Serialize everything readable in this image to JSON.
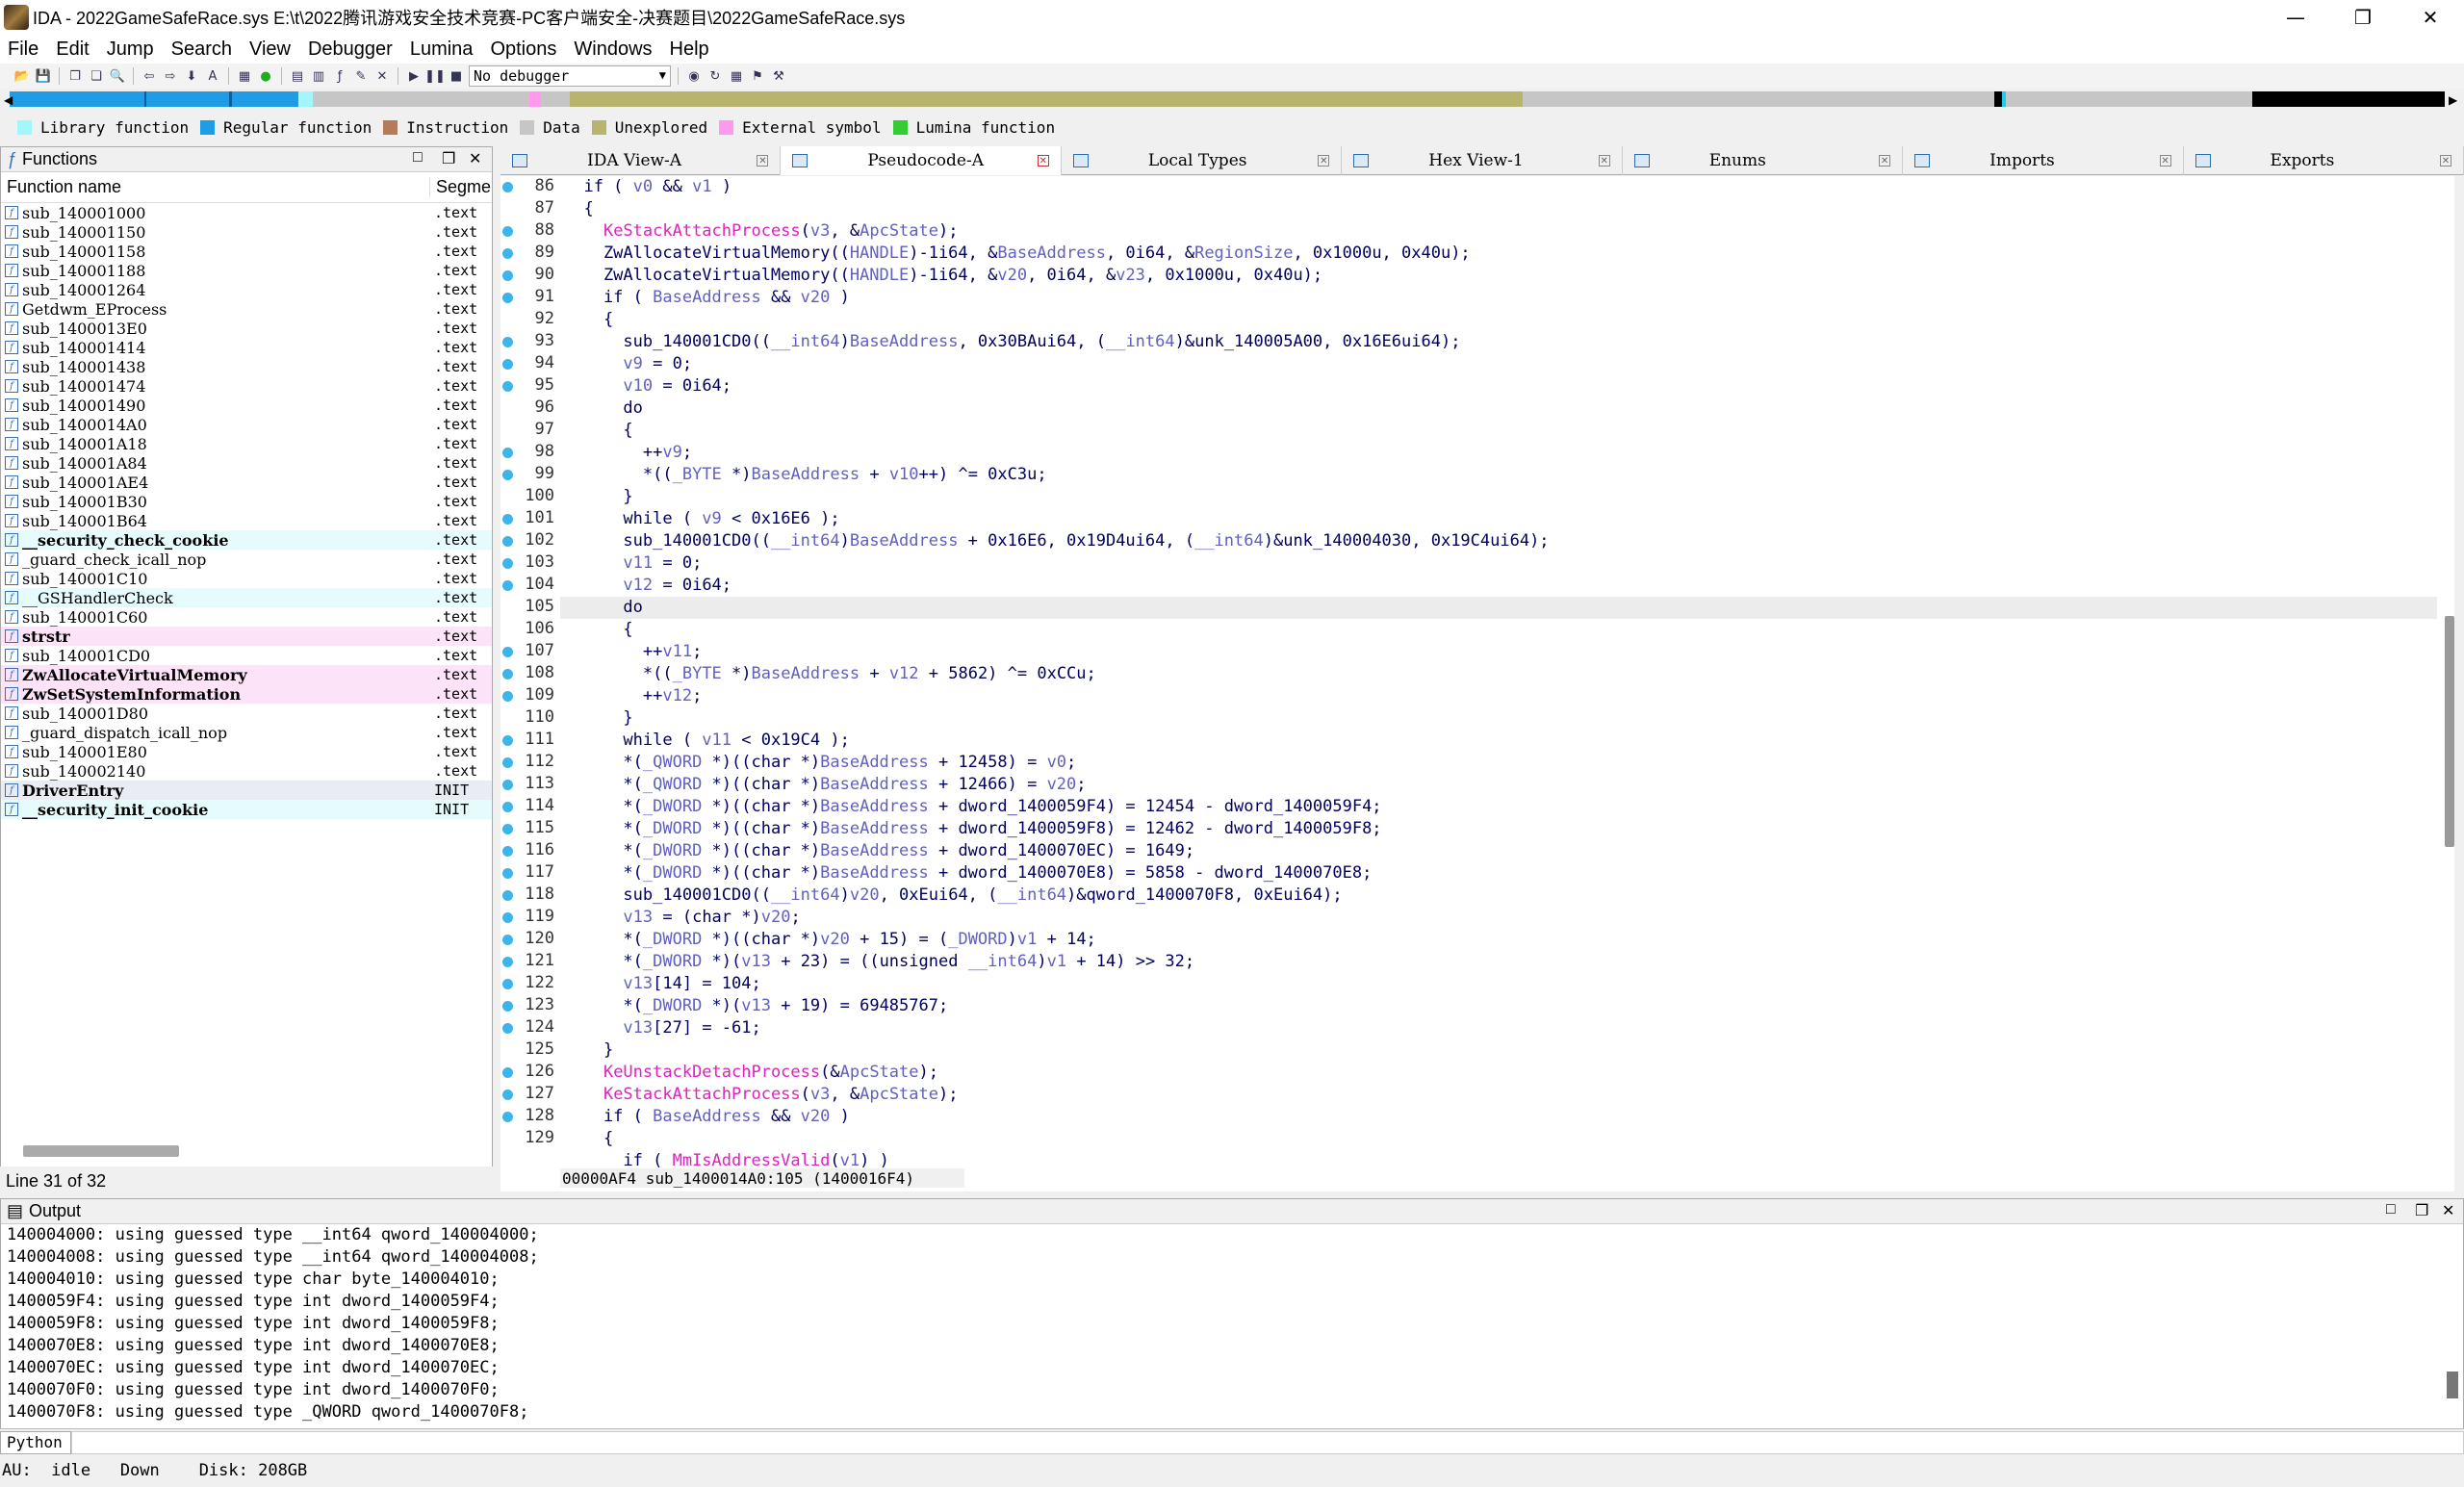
{
  "window": {
    "title": "IDA - 2022GameSafeRace.sys E:\\t\\2022腾讯游戏安全技术竞赛-PC客户端安全-决赛题目\\2022GameSafeRace.sys"
  },
  "menu": [
    "File",
    "Edit",
    "Jump",
    "Search",
    "View",
    "Debugger",
    "Lumina",
    "Options",
    "Windows",
    "Help"
  ],
  "toolbar": {
    "debugger": "No debugger"
  },
  "legend": [
    {
      "label": "Library function",
      "color": "#a3f6fb"
    },
    {
      "label": "Regular function",
      "color": "#1e9ce6"
    },
    {
      "label": "Instruction",
      "color": "#b47a5a"
    },
    {
      "label": "Data",
      "color": "#c6c6c6"
    },
    {
      "label": "Unexplored",
      "color": "#b8b46e"
    },
    {
      "label": "External symbol",
      "color": "#ff99ee"
    },
    {
      "label": "Lumina function",
      "color": "#33cc33"
    }
  ],
  "functions_panel": {
    "title": "Functions",
    "col_name": "Function name",
    "col_seg": "Segme",
    "rows": [
      {
        "name": "sub_140001000",
        "seg": ".text",
        "kind": ""
      },
      {
        "name": "sub_140001150",
        "seg": ".text",
        "kind": ""
      },
      {
        "name": "sub_140001158",
        "seg": ".text",
        "kind": ""
      },
      {
        "name": "sub_140001188",
        "seg": ".text",
        "kind": ""
      },
      {
        "name": "sub_140001264",
        "seg": ".text",
        "kind": ""
      },
      {
        "name": "Getdwm_EProcess",
        "seg": ".text",
        "kind": ""
      },
      {
        "name": "sub_1400013E0",
        "seg": ".text",
        "kind": ""
      },
      {
        "name": "sub_140001414",
        "seg": ".text",
        "kind": ""
      },
      {
        "name": "sub_140001438",
        "seg": ".text",
        "kind": ""
      },
      {
        "name": "sub_140001474",
        "seg": ".text",
        "kind": ""
      },
      {
        "name": "sub_140001490",
        "seg": ".text",
        "kind": ""
      },
      {
        "name": "sub_1400014A0",
        "seg": ".text",
        "kind": ""
      },
      {
        "name": "sub_140001A18",
        "seg": ".text",
        "kind": ""
      },
      {
        "name": "sub_140001A84",
        "seg": ".text",
        "kind": ""
      },
      {
        "name": "sub_140001AE4",
        "seg": ".text",
        "kind": ""
      },
      {
        "name": "sub_140001B30",
        "seg": ".text",
        "kind": ""
      },
      {
        "name": "sub_140001B64",
        "seg": ".text",
        "kind": ""
      },
      {
        "name": "__security_check_cookie",
        "seg": ".text",
        "kind": "lib bold"
      },
      {
        "name": "_guard_check_icall_nop",
        "seg": ".text",
        "kind": ""
      },
      {
        "name": "sub_140001C10",
        "seg": ".text",
        "kind": ""
      },
      {
        "name": "__GSHandlerCheck",
        "seg": ".text",
        "kind": "lib"
      },
      {
        "name": "sub_140001C60",
        "seg": ".text",
        "kind": ""
      },
      {
        "name": "strstr",
        "seg": ".text",
        "kind": "ext bold"
      },
      {
        "name": "sub_140001CD0",
        "seg": ".text",
        "kind": ""
      },
      {
        "name": "ZwAllocateVirtualMemory",
        "seg": ".text",
        "kind": "ext bold"
      },
      {
        "name": "ZwSetSystemInformation",
        "seg": ".text",
        "kind": "ext bold"
      },
      {
        "name": "sub_140001D80",
        "seg": ".text",
        "kind": ""
      },
      {
        "name": "_guard_dispatch_icall_nop",
        "seg": ".text",
        "kind": ""
      },
      {
        "name": "sub_140001E80",
        "seg": ".text",
        "kind": ""
      },
      {
        "name": "sub_140002140",
        "seg": ".text",
        "kind": ""
      },
      {
        "name": "DriverEntry",
        "seg": "INIT",
        "kind": "sel bold"
      },
      {
        "name": "__security_init_cookie",
        "seg": "INIT",
        "kind": "lib bold"
      }
    ],
    "line_info": "Line 31 of 32"
  },
  "tabs": [
    {
      "label": "IDA View-A",
      "active": false
    },
    {
      "label": "Pseudocode-A",
      "active": true
    },
    {
      "label": "Local Types",
      "active": false
    },
    {
      "label": "Hex View-1",
      "active": false
    },
    {
      "label": "Enums",
      "active": false
    },
    {
      "label": "Imports",
      "active": false
    },
    {
      "label": "Exports",
      "active": false
    }
  ],
  "code": {
    "lines": [
      {
        "n": "86",
        "dot": true,
        "t": "  if ( v0 && v1 )"
      },
      {
        "n": "87",
        "dot": false,
        "t": "  {"
      },
      {
        "n": "88",
        "dot": true,
        "t": "    KeStackAttachProcess(v3, &ApcState);"
      },
      {
        "n": "89",
        "dot": true,
        "t": "    ZwAllocateVirtualMemory((HANDLE)-1i64, &BaseAddress, 0i64, &RegionSize, 0x1000u, 0x40u);"
      },
      {
        "n": "90",
        "dot": true,
        "t": "    ZwAllocateVirtualMemory((HANDLE)-1i64, &v20, 0i64, &v23, 0x1000u, 0x40u);"
      },
      {
        "n": "91",
        "dot": true,
        "t": "    if ( BaseAddress && v20 )"
      },
      {
        "n": "92",
        "dot": false,
        "t": "    {"
      },
      {
        "n": "93",
        "dot": true,
        "t": "      sub_140001CD0((__int64)BaseAddress, 0x30BAui64, (__int64)&unk_140005A00, 0x16E6ui64);"
      },
      {
        "n": "94",
        "dot": true,
        "t": "      v9 = 0;"
      },
      {
        "n": "95",
        "dot": true,
        "t": "      v10 = 0i64;"
      },
      {
        "n": "96",
        "dot": false,
        "t": "      do"
      },
      {
        "n": "97",
        "dot": false,
        "t": "      {"
      },
      {
        "n": "98",
        "dot": true,
        "t": "        ++v9;"
      },
      {
        "n": "99",
        "dot": true,
        "t": "        *((_BYTE *)BaseAddress + v10++) ^= 0xC3u;"
      },
      {
        "n": "100",
        "dot": false,
        "t": "      }"
      },
      {
        "n": "101",
        "dot": true,
        "t": "      while ( v9 < 0x16E6 );"
      },
      {
        "n": "102",
        "dot": true,
        "t": "      sub_140001CD0((__int64)BaseAddress + 0x16E6, 0x19D4ui64, (__int64)&unk_140004030, 0x19C4ui64);"
      },
      {
        "n": "103",
        "dot": true,
        "t": "      v11 = 0;"
      },
      {
        "n": "104",
        "dot": true,
        "t": "      v12 = 0i64;"
      },
      {
        "n": "105",
        "dot": false,
        "t": "      do",
        "cur": true
      },
      {
        "n": "106",
        "dot": false,
        "t": "      {"
      },
      {
        "n": "107",
        "dot": true,
        "t": "        ++v11;"
      },
      {
        "n": "108",
        "dot": true,
        "t": "        *((_BYTE *)BaseAddress + v12 + 5862) ^= 0xCCu;"
      },
      {
        "n": "109",
        "dot": true,
        "t": "        ++v12;"
      },
      {
        "n": "110",
        "dot": false,
        "t": "      }"
      },
      {
        "n": "111",
        "dot": true,
        "t": "      while ( v11 < 0x19C4 );"
      },
      {
        "n": "112",
        "dot": true,
        "t": "      *(_QWORD *)((char *)BaseAddress + 12458) = v0;"
      },
      {
        "n": "113",
        "dot": true,
        "t": "      *(_QWORD *)((char *)BaseAddress + 12466) = v20;"
      },
      {
        "n": "114",
        "dot": true,
        "t": "      *(_DWORD *)((char *)BaseAddress + dword_1400059F4) = 12454 - dword_1400059F4;"
      },
      {
        "n": "115",
        "dot": true,
        "t": "      *(_DWORD *)((char *)BaseAddress + dword_1400059F8) = 12462 - dword_1400059F8;"
      },
      {
        "n": "116",
        "dot": true,
        "t": "      *(_DWORD *)((char *)BaseAddress + dword_1400070EC) = 1649;"
      },
      {
        "n": "117",
        "dot": true,
        "t": "      *(_DWORD *)((char *)BaseAddress + dword_1400070E8) = 5858 - dword_1400070E8;"
      },
      {
        "n": "118",
        "dot": true,
        "t": "      sub_140001CD0((__int64)v20, 0xEui64, (__int64)&qword_1400070F8, 0xEui64);"
      },
      {
        "n": "119",
        "dot": true,
        "t": "      v13 = (char *)v20;"
      },
      {
        "n": "120",
        "dot": true,
        "t": "      *(_DWORD *)((char *)v20 + 15) = (_DWORD)v1 + 14;"
      },
      {
        "n": "121",
        "dot": true,
        "t": "      *(_DWORD *)(v13 + 23) = ((unsigned __int64)v1 + 14) >> 32;"
      },
      {
        "n": "122",
        "dot": true,
        "t": "      v13[14] = 104;"
      },
      {
        "n": "123",
        "dot": true,
        "t": "      *(_DWORD *)(v13 + 19) = 69485767;"
      },
      {
        "n": "124",
        "dot": true,
        "t": "      v13[27] = -61;"
      },
      {
        "n": "125",
        "dot": false,
        "t": "    }"
      },
      {
        "n": "126",
        "dot": true,
        "t": "    KeUnstackDetachProcess(&ApcState);"
      },
      {
        "n": "127",
        "dot": true,
        "t": "    KeStackAttachProcess(v3, &ApcState);"
      },
      {
        "n": "128",
        "dot": true,
        "t": "    if ( BaseAddress && v20 )"
      },
      {
        "n": "129",
        "dot": false,
        "t": "    {"
      },
      {
        "n": "",
        "dot": false,
        "t": "      if ( MmIsAddressValid(v1) )"
      }
    ],
    "status": "00000AF4 sub_1400014A0:105 (1400016F4)"
  },
  "output_panel": {
    "title": "Output",
    "lines": [
      "140004000: using guessed type __int64 qword_140004000;",
      "140004008: using guessed type __int64 qword_140004008;",
      "140004010: using guessed type char byte_140004010;",
      "1400059F4: using guessed type int dword_1400059F4;",
      "1400059F8: using guessed type int dword_1400059F8;",
      "1400070E8: using guessed type int dword_1400070E8;",
      "1400070EC: using guessed type int dword_1400070EC;",
      "1400070F0: using guessed type int dword_1400070F0;",
      "1400070F8: using guessed type _QWORD qword_1400070F8;"
    ]
  },
  "python_label": "Python",
  "au_status": "AU:  idle   Down    Disk: 208GB"
}
